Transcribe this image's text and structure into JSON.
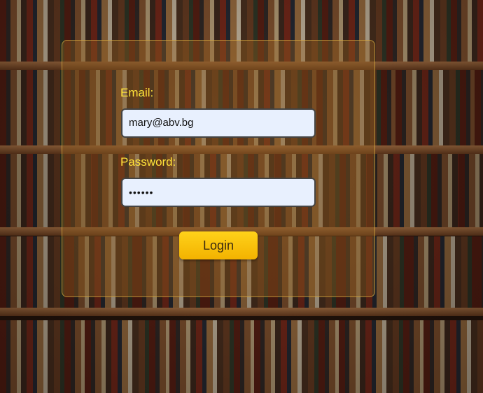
{
  "login_form": {
    "email_label": "Email:",
    "email_value": "mary@abv.bg",
    "password_label": "Password:",
    "password_value": "••••••",
    "login_button_label": "Login"
  },
  "colors": {
    "label_color": "#ffe23a",
    "button_color": "#ffd21a",
    "input_background": "#e8f0fe"
  }
}
